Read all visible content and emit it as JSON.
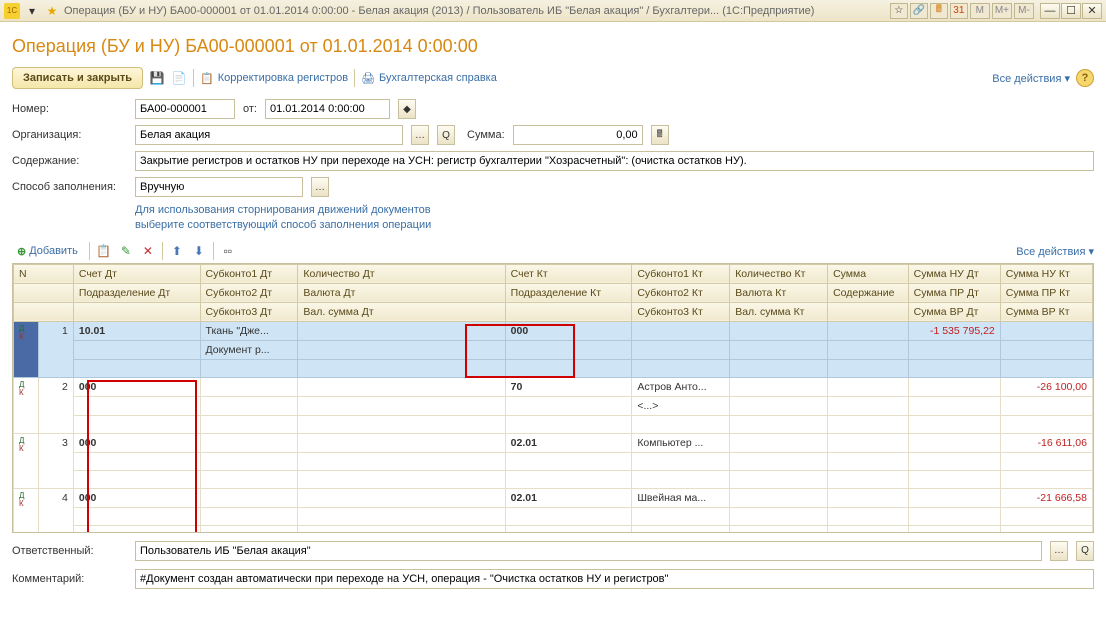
{
  "titlebar": {
    "text": "Операция (БУ и НУ) БА00-000001 от 01.01.2014 0:00:00 - Белая акация (2013) / Пользователь ИБ \"Белая акация\" / Бухгалтери...   (1С:Предприятие)",
    "m1": "M",
    "m2": "M+",
    "m3": "M-"
  },
  "doc_title": "Операция (БУ и НУ) БА00-000001 от 01.01.2014 0:00:00",
  "toolbar": {
    "save_close": "Записать и закрыть",
    "reg_corr": "Корректировка регистров",
    "acc_ref": "Бухгалтерская справка",
    "all_actions": "Все действия ▾"
  },
  "form": {
    "number_label": "Номер:",
    "number_value": "БА00-000001",
    "from_label": "от:",
    "date_value": "01.01.2014 0:00:00",
    "org_label": "Организация:",
    "org_value": "Белая акация",
    "sum_label": "Сумма:",
    "sum_value": "0,00",
    "content_label": "Содержание:",
    "content_value": "Закрытие регистров и остатков НУ при переходе на УСН: регистр бухгалтерии \"Хозрасчетный\": (очистка остатков НУ).",
    "method_label": "Способ заполнения:",
    "method_value": "Вручную",
    "hint1": "Для использования сторнирования движений документов",
    "hint2": "выберите соответствующий способ заполнения операции"
  },
  "table_toolbar": {
    "add": "Добавить",
    "all_actions": "Все действия ▾"
  },
  "headers": {
    "n": "N",
    "acc_dt": "Счет Дт",
    "dept_dt": "Подразделение Дт",
    "sub1_dt": "Субконто1 Дт",
    "sub2_dt": "Субконто2 Дт",
    "sub3_dt": "Субконто3 Дт",
    "qty_dt": "Количество Дт",
    "curr_dt": "Валюта Дт",
    "valsum_dt": "Вал. сумма Дт",
    "acc_kt": "Счет Кт",
    "dept_kt": "Подразделение Кт",
    "sub1_kt": "Субконто1 Кт",
    "sub2_kt": "Субконто2 Кт",
    "sub3_kt": "Субконто3 Кт",
    "qty_kt": "Количество Кт",
    "curr_kt": "Валюта Кт",
    "valsum_kt": "Вал. сумма Кт",
    "sum": "Сумма",
    "content": "Содержание",
    "sum_nu_dt": "Сумма НУ Дт",
    "sum_pr_dt": "Сумма ПР Дт",
    "sum_vr_dt": "Сумма ВР Дт",
    "sum_nu_kt": "Сумма НУ Кт",
    "sum_pr_kt": "Сумма ПР Кт",
    "sum_vr_kt": "Сумма ВР Кт"
  },
  "rows": [
    {
      "n": "1",
      "acc_dt": "10.01",
      "sub1_dt": "Ткань \"Дже...",
      "sub2_dt": "Документ р...",
      "acc_kt": "000",
      "sub1_kt": "",
      "sum_nu_dt": "-1 535 795,22",
      "sum_nu_kt": ""
    },
    {
      "n": "2",
      "acc_dt": "000",
      "sub1_dt": "",
      "sub2_dt": "",
      "acc_kt": "70",
      "sub1_kt": "Астров Анто...",
      "sub2_kt": "<...>",
      "sum_nu_dt": "",
      "sum_nu_kt": "-26 100,00"
    },
    {
      "n": "3",
      "acc_dt": "000",
      "sub1_dt": "",
      "sub2_dt": "",
      "acc_kt": "02.01",
      "sub1_kt": "Компьютер ...",
      "sub2_kt": "",
      "sum_nu_dt": "",
      "sum_nu_kt": "-16 611,06"
    },
    {
      "n": "4",
      "acc_dt": "000",
      "sub1_dt": "",
      "sub2_dt": "",
      "acc_kt": "02.01",
      "sub1_kt": "Швейная ма...",
      "sub2_kt": "",
      "sum_nu_dt": "",
      "sum_nu_kt": "-21 666,58"
    }
  ],
  "footer": {
    "resp_label": "Ответственный:",
    "resp_value": "Пользователь ИБ \"Белая акация\"",
    "comment_label": "Комментарий:",
    "comment_value": "#Документ создан автоматически при переходе на УСН, операция - \"Очистка остатков НУ и регистров\""
  }
}
